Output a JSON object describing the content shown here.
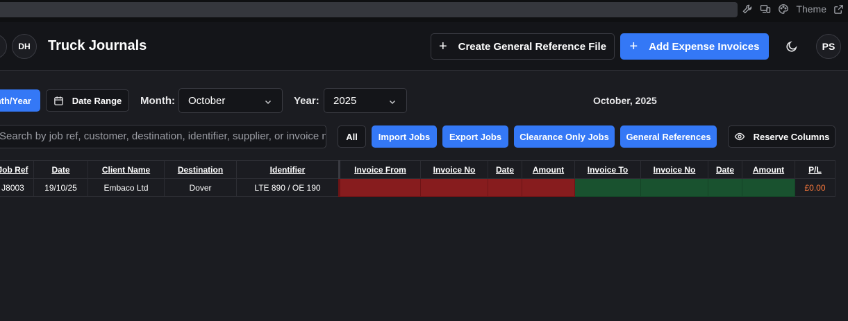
{
  "topbar": {
    "theme_label": "Theme",
    "icons": [
      "wrench-icon",
      "devices-icon",
      "palette-icon",
      "external-link-icon"
    ]
  },
  "header": {
    "title": "Truck Journals",
    "avatar_left": "DH",
    "avatar_right": "PS",
    "create_button": "Create General Reference File",
    "add_button": "Add Expense Invoices",
    "theme_toggle_icon": "moon-icon"
  },
  "filters": {
    "month_year_button": "Month/Year",
    "date_range_button": "Date Range",
    "month_label": "Month:",
    "month_value": "October",
    "year_label": "Year:",
    "year_value": "2025",
    "period_display": "October, 2025"
  },
  "search": {
    "placeholder": "Search by job ref, customer, destination, identifier, supplier, or invoice number"
  },
  "job_filters": {
    "all": "All",
    "import": "Import Jobs",
    "export": "Export Jobs",
    "clearance": "Clearance Only Jobs",
    "general": "General References",
    "reserve": "Reserve Columns"
  },
  "table": {
    "headers": [
      "Job Ref",
      "Date",
      "Client Name",
      "Destination",
      "Identifier",
      "Invoice From",
      "Invoice No",
      "Date",
      "Amount",
      "Invoice To",
      "Invoice No",
      "Date",
      "Amount",
      "P/L"
    ],
    "rows": [
      {
        "job_ref": "J8003",
        "date": "19/10/25",
        "client": "Embaco Ltd",
        "destination": "Dover",
        "identifier": "LTE 890 / OE 190",
        "inv_from": "",
        "inv_no": "",
        "inv_date": "",
        "amount": "",
        "inv_to": "",
        "inv_no2": "",
        "inv_date2": "",
        "amount2": "",
        "pl": "£0.00"
      }
    ]
  },
  "colors": {
    "accent": "#3478f6",
    "expense_cell": "#871c1e",
    "income_cell": "#19522f",
    "pl_text": "#ff7a3c"
  }
}
